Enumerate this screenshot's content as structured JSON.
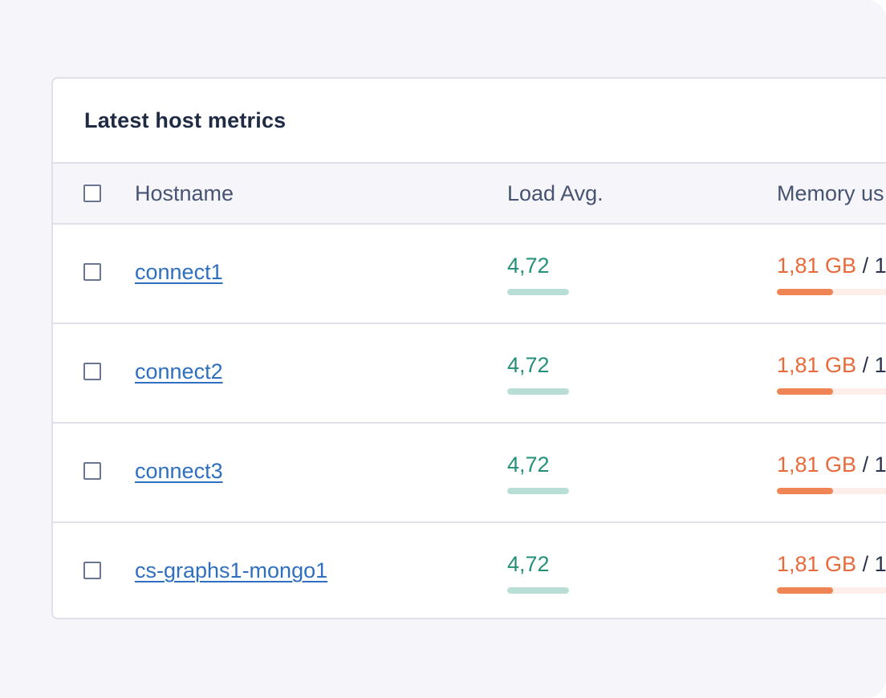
{
  "card": {
    "title": "Latest host metrics"
  },
  "table": {
    "columns": [
      "Hostname",
      "Load Avg.",
      "Memory us"
    ],
    "rows": [
      {
        "hostname": "connect1",
        "load": "4,72",
        "load_level": 1.0,
        "mem_used": "1,81 GB",
        "mem_rest": " / 1",
        "mem_fraction": 0.35
      },
      {
        "hostname": "connect2",
        "load": "4,72",
        "load_level": 1.0,
        "mem_used": "1,81 GB",
        "mem_rest": " / 1",
        "mem_fraction": 0.35
      },
      {
        "hostname": "connect3",
        "load": "4,72",
        "load_level": 1.0,
        "mem_used": "1,81 GB",
        "mem_rest": " / 1",
        "mem_fraction": 0.35
      },
      {
        "hostname": "cs-graphs1-mongo1",
        "load": "4,72",
        "load_level": 1.0,
        "mem_used": "1,81 GB",
        "mem_rest": " / 1",
        "mem_fraction": 0.35
      }
    ]
  },
  "colors": {
    "load_bar": "#b9ded6",
    "mem_bar_fill": "#ef8455",
    "mem_bar_track": "#fdeeea"
  }
}
